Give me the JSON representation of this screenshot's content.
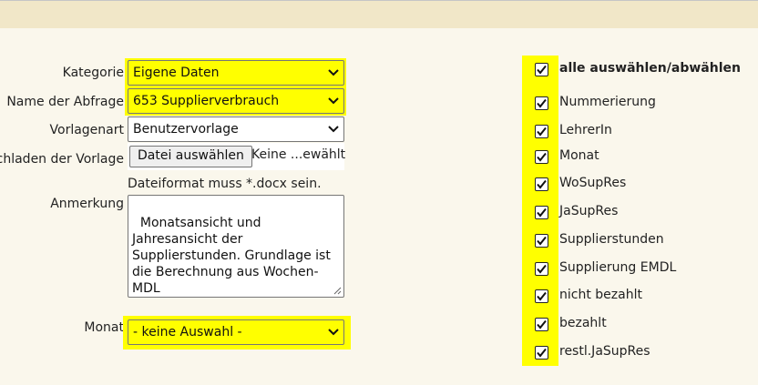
{
  "form": {
    "kategorie": {
      "label": "Kategorie",
      "value": "Eigene Daten"
    },
    "name": {
      "label": "Name der Abfrage",
      "value": "653 Supplierverbrauch"
    },
    "vorlagenart": {
      "label": "Vorlagenart",
      "value": "Benutzervorlage"
    },
    "upload": {
      "label": "ochladen der Vorlage",
      "button": "Datei auswählen",
      "status": "Keine ...ewählt",
      "hint": "Dateiformat muss *.docx sein."
    },
    "anmerkung": {
      "label": "Anmerkung",
      "value": "Monatsansicht und Jahresansicht der Supplierstunden. Grundlage ist die Berechnung aus Wochen-MDL"
    },
    "monat": {
      "label": "Monat",
      "value": "- keine Auswahl -"
    }
  },
  "columns": {
    "select_all": "alle auswählen/abwählen",
    "items": [
      {
        "label": "Nummerierung",
        "checked": true
      },
      {
        "label": "LehrerIn",
        "checked": true
      },
      {
        "label": "Monat",
        "checked": true
      },
      {
        "label": "WoSupRes",
        "checked": true
      },
      {
        "label": "JaSupRes",
        "checked": true
      },
      {
        "label": "Supplierstunden",
        "checked": true
      },
      {
        "label": "Supplierung EMDL",
        "checked": true
      },
      {
        "label": "nicht bezahlt",
        "checked": true
      },
      {
        "label": "bezahlt",
        "checked": true
      },
      {
        "label": "restl.JaSupRes",
        "checked": true
      }
    ]
  },
  "colors": {
    "highlight": "#ffff00",
    "background": "#faf7ec",
    "topbar": "#f1e7c8"
  }
}
